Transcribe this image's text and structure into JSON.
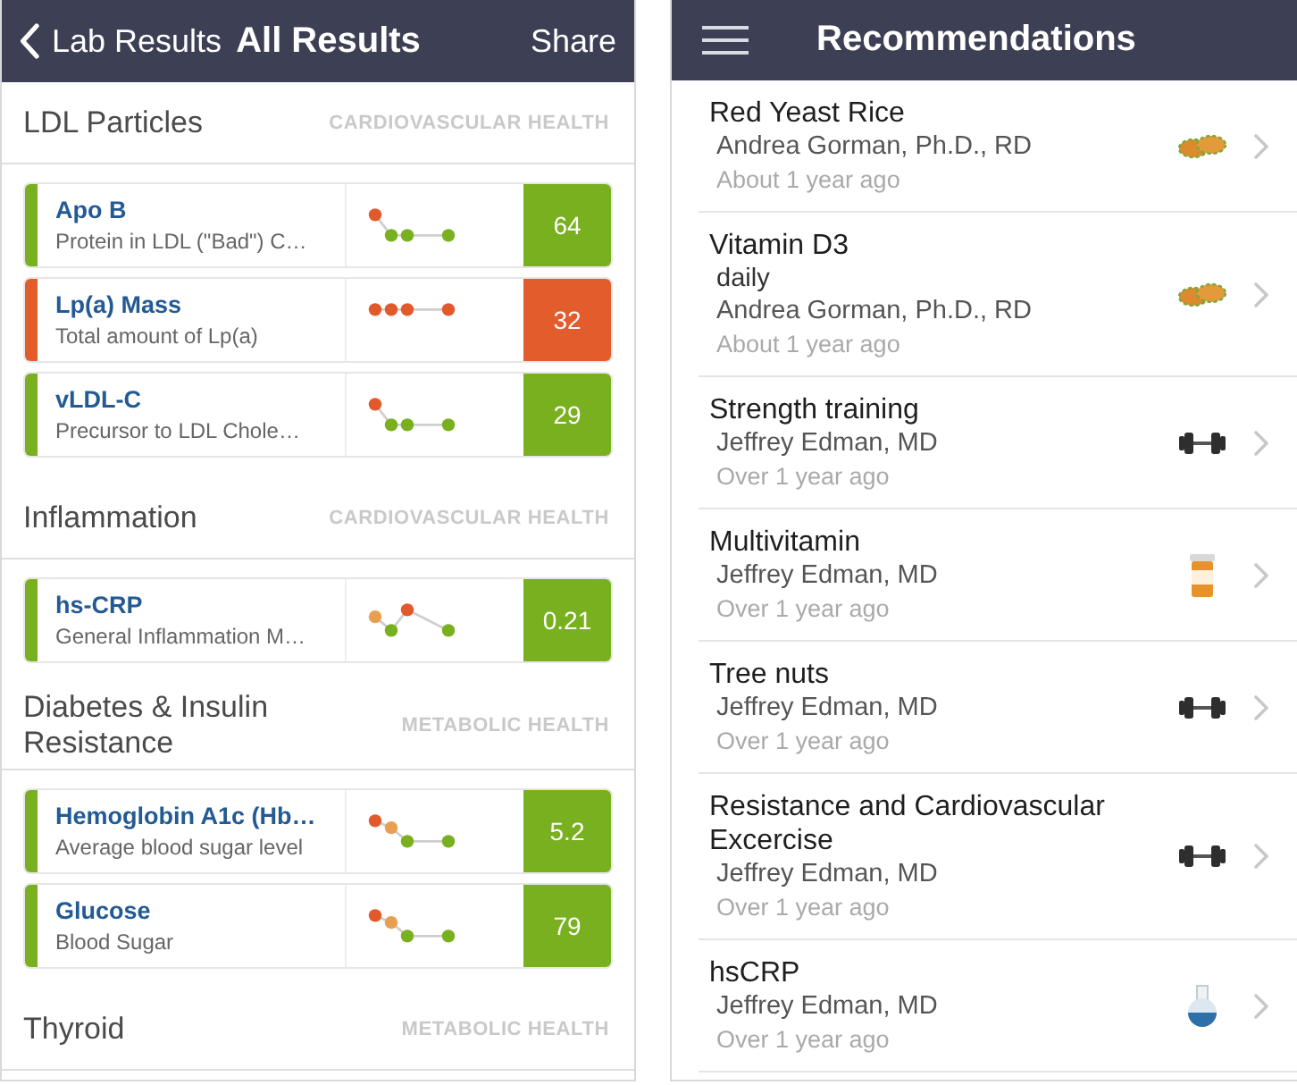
{
  "left_screen": {
    "header": {
      "back": "Lab Results",
      "title": "All Results",
      "action": "Share"
    },
    "sections": [
      {
        "title": "LDL Particles",
        "category": "CARDIOVASCULAR HEALTH",
        "results": [
          {
            "name": "Apo B",
            "description": "Protein in LDL (\"Bad\") C…",
            "value": "64",
            "color": "#79b01f",
            "trend": [
              {
                "color": "#e2592b"
              },
              {
                "color": "#79b01f"
              },
              {
                "color": "#79b01f"
              },
              {
                "color": "#79b01f"
              }
            ]
          },
          {
            "name": "Lp(a) Mass",
            "description": "Total amount of Lp(a)",
            "value": "32",
            "color": "#e35c2b",
            "trend": [
              {
                "color": "#e2592b"
              },
              {
                "color": "#e2592b"
              },
              {
                "color": "#e2592b"
              },
              {
                "color": "#e2592b"
              }
            ]
          },
          {
            "name": "vLDL-C",
            "description": "Precursor to LDL Chole…",
            "value": "29",
            "color": "#79b01f",
            "trend": [
              {
                "color": "#e2592b"
              },
              {
                "color": "#79b01f"
              },
              {
                "color": "#79b01f"
              },
              {
                "color": "#79b01f"
              }
            ]
          }
        ]
      },
      {
        "title": "Inflammation",
        "category": "CARDIOVASCULAR HEALTH",
        "results": [
          {
            "name": "hs-CRP",
            "description": "General Inflammation M…",
            "value": "0.21",
            "color": "#79b01f",
            "trend": [
              {
                "color": "#e8a050"
              },
              {
                "color": "#79b01f"
              },
              {
                "color": "#e2592b"
              },
              {
                "color": "#79b01f"
              }
            ]
          }
        ]
      },
      {
        "title": "Diabetes & Insulin Resistance",
        "category": "METABOLIC HEALTH",
        "results": [
          {
            "name": "Hemoglobin A1c (Hb…",
            "description": "Average blood sugar level",
            "value": "5.2",
            "color": "#79b01f",
            "trend": [
              {
                "color": "#e2592b"
              },
              {
                "color": "#e8a050"
              },
              {
                "color": "#79b01f"
              },
              {
                "color": "#79b01f"
              }
            ]
          },
          {
            "name": "Glucose",
            "description": "Blood Sugar",
            "value": "79",
            "color": "#79b01f",
            "trend": [
              {
                "color": "#e2592b"
              },
              {
                "color": "#e8a050"
              },
              {
                "color": "#79b01f"
              },
              {
                "color": "#79b01f"
              }
            ]
          }
        ]
      },
      {
        "title": "Thyroid",
        "category": "METABOLIC HEALTH"
      }
    ]
  },
  "right_screen": {
    "header": {
      "title": "Recommendations"
    },
    "items": [
      {
        "title": "Red Yeast Rice",
        "author": "Andrea Gorman, Ph.D., RD",
        "time": "About 1 year ago",
        "kind": "supplement"
      },
      {
        "title": "Vitamin D3",
        "note": "daily",
        "author": "Andrea Gorman, Ph.D., RD",
        "time": "About 1 year ago",
        "kind": "supplement"
      },
      {
        "title": "Strength training",
        "author": "Jeffrey Edman, MD",
        "time": "Over 1 year ago",
        "kind": "exercise"
      },
      {
        "title": "Multivitamin",
        "author": "Jeffrey Edman, MD",
        "time": "Over 1 year ago",
        "kind": "medication"
      },
      {
        "title": "Tree nuts",
        "author": "Jeffrey Edman, MD",
        "time": "Over 1 year ago",
        "kind": "exercise"
      },
      {
        "title": "Resistance and Cardiovascular Excercise",
        "author": "Jeffrey Edman, MD",
        "time": "Over 1 year ago",
        "kind": "exercise"
      },
      {
        "title": "hsCRP",
        "author": "Jeffrey Edman, MD",
        "time": "Over 1 year ago",
        "kind": "lab-test"
      }
    ]
  }
}
